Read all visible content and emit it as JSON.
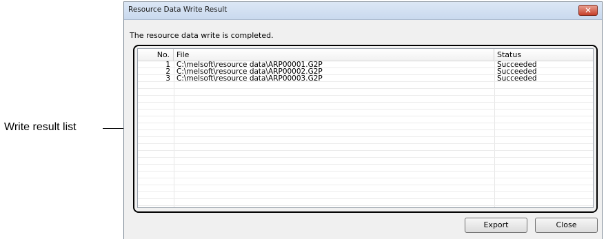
{
  "callout": {
    "label": "Write result list"
  },
  "dialog": {
    "title": "Resource Data Write Result",
    "close_glyph": "✕",
    "message": "The resource data write is completed.",
    "list": {
      "columns": [
        "No.",
        "File",
        "Status"
      ],
      "rows": [
        {
          "no": "1",
          "file": "C:\\melsoft\\resource data\\ARP00001.G2P",
          "status": "Succeeded"
        },
        {
          "no": "2",
          "file": "C:\\melsoft\\resource data\\ARP00002.G2P",
          "status": "Succeeded"
        },
        {
          "no": "3",
          "file": "C:\\melsoft\\resource data\\ARP00003.G2P",
          "status": "Succeeded"
        }
      ]
    },
    "buttons": {
      "export_label": "Export",
      "close_label": "Close"
    },
    "icons": {
      "close": "close-icon"
    },
    "colors": {
      "close_button": "#c7402a",
      "titlebar": "#dce7f5"
    }
  }
}
